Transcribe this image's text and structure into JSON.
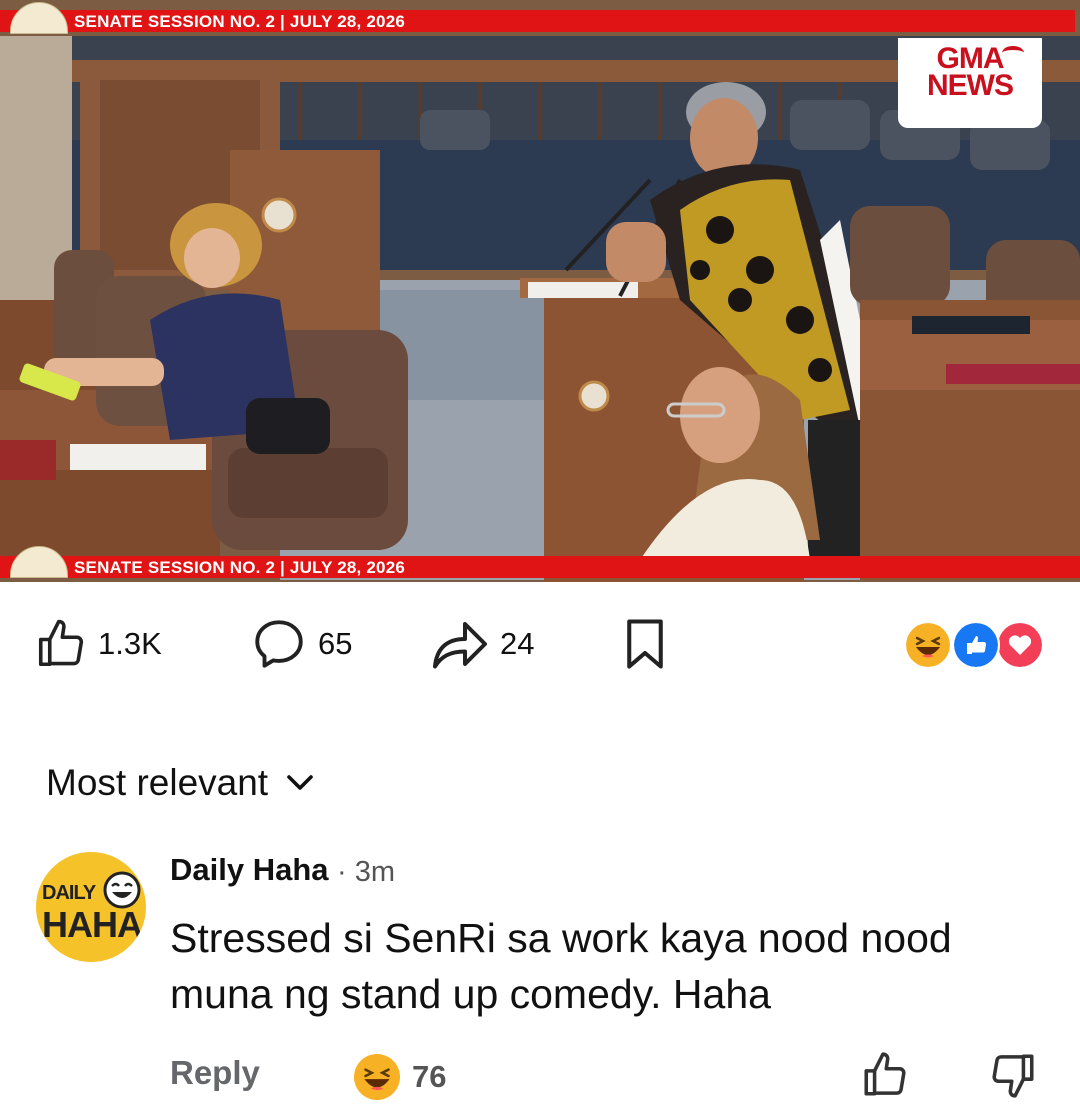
{
  "video": {
    "banner_top": "SENATE SESSION NO. 2 | JULY 28, 2026",
    "banner_bottom": "SENATE SESSION NO. 2 | JULY 28, 2026",
    "logo_line1": "GMA",
    "logo_line2": "NEWS"
  },
  "actions": {
    "likes": "1.3K",
    "comments": "65",
    "shares": "24",
    "reaction_icons": [
      "haha-icon",
      "like-icon",
      "love-icon"
    ]
  },
  "comments_section": {
    "sort_label": "Most relevant",
    "comments": [
      {
        "avatar_line1": "DAILY",
        "avatar_line2": "HAHA",
        "author": "Daily Haha",
        "time": "· 3m",
        "text": "Stressed si SenRi sa work kaya nood nood muna ng stand up comedy. Haha",
        "reply_label": "Reply",
        "reaction_count": "76"
      }
    ]
  },
  "colors": {
    "banner_red": "#e01414",
    "gma_red": "#c8101e",
    "reaction_blue": "#1877f2",
    "reaction_red": "#f33e58",
    "haha_yellow": "#f7b125",
    "avatar_yellow": "#f5c22a"
  }
}
